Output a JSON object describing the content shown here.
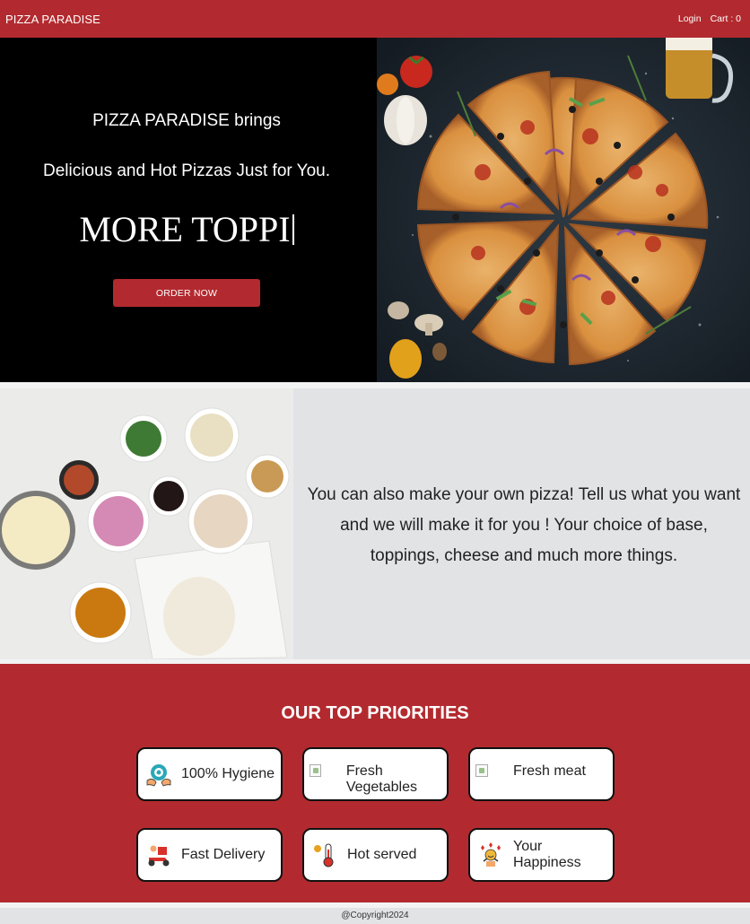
{
  "navbar": {
    "brand": "PIZZA PARADISE",
    "login": "Login",
    "cart": "Cart : 0"
  },
  "hero": {
    "line1": "PIZZA PARADISE brings",
    "line2": "Delicious and Hot Pizzas Just for You.",
    "typed": "MORE TOPPI",
    "order_button": "ORDER NOW"
  },
  "custom": {
    "text": "You can also make your own pizza! Tell us what you want and we will make it for you ! Your choice of base, toppings, cheese and much more things."
  },
  "priorities": {
    "title": "OUR TOP PRIORITIES",
    "cards": [
      {
        "label": "100% Hygiene",
        "icon": "hygiene-icon"
      },
      {
        "label": "Fresh Vegetables",
        "icon": "broken-image-icon"
      },
      {
        "label": "Fresh meat",
        "icon": "broken-image-icon"
      },
      {
        "label": "Fast Delivery",
        "icon": "delivery-scooter-icon"
      },
      {
        "label": "Hot served",
        "icon": "thermometer-icon"
      },
      {
        "label": "Your Happiness",
        "icon": "happiness-icon"
      }
    ]
  },
  "footer": {
    "copyright": "@Copyright2024"
  },
  "colors": {
    "primary": "#b22a2f",
    "section_bg": "#e1e3e5",
    "hero_bg": "#000000"
  }
}
